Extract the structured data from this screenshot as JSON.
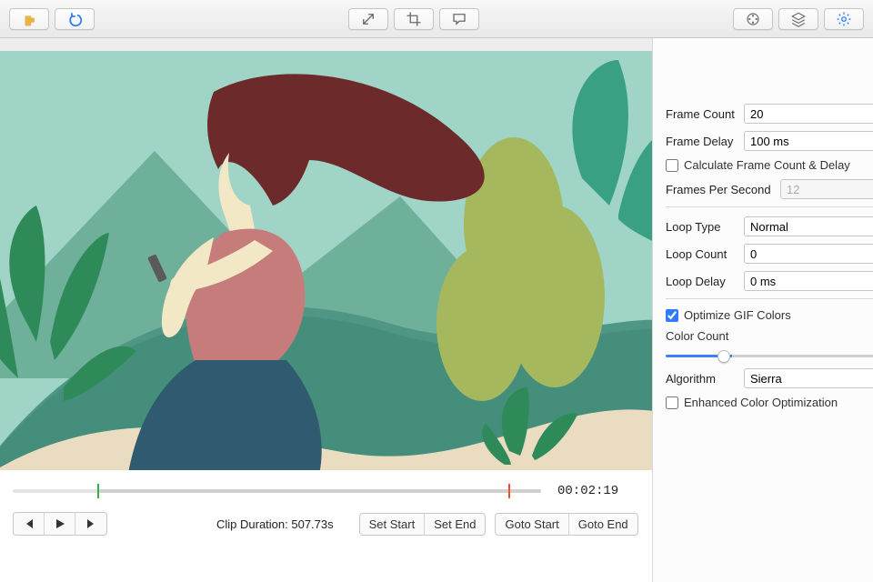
{
  "toolbar": {
    "icons": [
      "beer-icon",
      "undo-icon",
      "resize-icon",
      "crop-icon",
      "speech-icon",
      "film-icon",
      "layers-icon",
      "gear-icon"
    ]
  },
  "sidebar": {
    "frame_count_label": "Frame Count",
    "frame_count_value": "20",
    "frame_delay_label": "Frame Delay",
    "frame_delay_value": "100 ms",
    "calc_label": "Calculate Frame Count & Delay",
    "calc_checked": false,
    "fps_label": "Frames Per Second",
    "fps_value": "12",
    "loop_type_label": "Loop Type",
    "loop_type_value": "Normal",
    "loop_count_label": "Loop Count",
    "loop_count_value": "0",
    "loop_delay_label": "Loop Delay",
    "loop_delay_value": "0 ms",
    "optimize_label": "Optimize GIF Colors",
    "optimize_checked": true,
    "color_count_label": "Color Count",
    "color_count_value": "48",
    "algorithm_label": "Algorithm",
    "algorithm_value": "Sierra",
    "enhanced_label": "Enhanced Color Optimization",
    "enhanced_checked": false
  },
  "timeline": {
    "timecode": "00:02:19",
    "clip_duration_label": "Clip Duration: 507.73s",
    "set_start": "Set Start",
    "set_end": "Set End",
    "goto_start": "Goto Start",
    "goto_end": "Goto End"
  }
}
